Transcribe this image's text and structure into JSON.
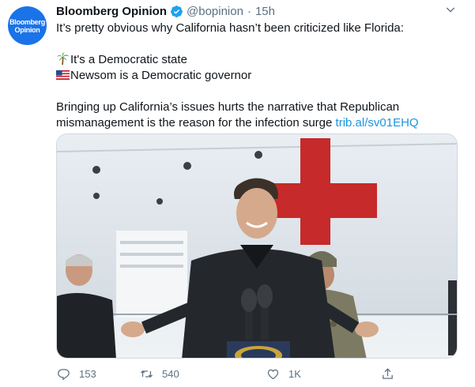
{
  "tweet": {
    "avatar_lines": [
      "Bloomberg",
      "Opinion"
    ],
    "author_name": "Bloomberg Opinion",
    "handle": "@bopinion",
    "separator": "·",
    "time": "15h",
    "lines": [
      "It’s pretty obvious why California hasn’t been criticized like Florida:",
      "It's a Democratic state",
      "Newsom is a Democratic governor",
      "Bringing up California’s issues hurts the narrative that Republican",
      "mismanagement is the reason for the infection surge "
    ],
    "link_text": "trib.al/sv01EHQ",
    "emoji_icons": [
      "palm-tree-emoji",
      "us-flag-emoji"
    ]
  },
  "actions": {
    "reply_count": "153",
    "retweet_count": "540",
    "like_count": "1K"
  },
  "colors": {
    "brand_blue": "#1a73e8",
    "link": "#1b95e0",
    "muted": "#5b7083",
    "verified": "#1da1f2",
    "cross_red": "#c62a2a"
  },
  "icons": {
    "verified": "verified-badge-icon",
    "caret": "chevron-down-icon",
    "reply": "reply-icon",
    "retweet": "retweet-icon",
    "like": "heart-icon",
    "share": "share-icon"
  }
}
